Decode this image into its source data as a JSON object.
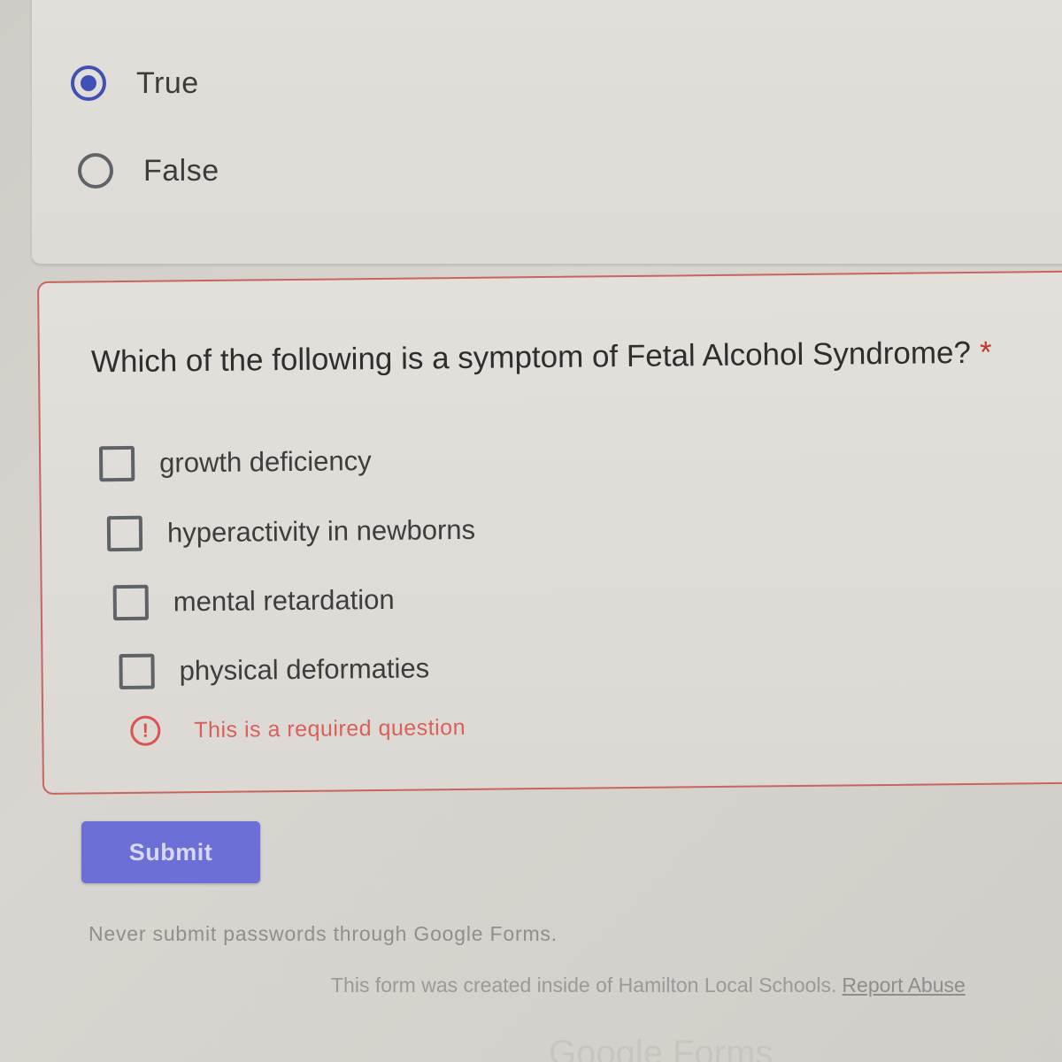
{
  "previous_question": {
    "options": [
      {
        "label": "True",
        "selected": true
      },
      {
        "label": "False",
        "selected": false
      }
    ]
  },
  "question": {
    "title": "Which of the following is a symptom of Fetal Alcohol Syndrome?",
    "required_marker": "*",
    "options": [
      {
        "label": "growth deficiency",
        "checked": false
      },
      {
        "label": "hyperactivity in newborns",
        "checked": false
      },
      {
        "label": "mental retardation",
        "checked": false
      },
      {
        "label": "physical deformaties",
        "checked": false
      }
    ],
    "error_icon": "!",
    "error_text": "This is a required question"
  },
  "submit_label": "Submit",
  "footer": {
    "warning": "Never submit passwords through Google Forms.",
    "created_text": "This form was created inside of Hamilton Local Schools.",
    "report_link": "Report Abuse",
    "logo_text": "Google Forms"
  },
  "colors": {
    "accent": "#3f51b5",
    "submit_button": "#6c6fd6",
    "error": "#d9534f",
    "error_border": "#c7655f"
  },
  "icons": {
    "radio_selected": "radio-checked-icon",
    "radio_unselected": "radio-unchecked-icon",
    "checkbox": "checkbox-unchecked-icon",
    "error": "error-exclamation-icon"
  }
}
